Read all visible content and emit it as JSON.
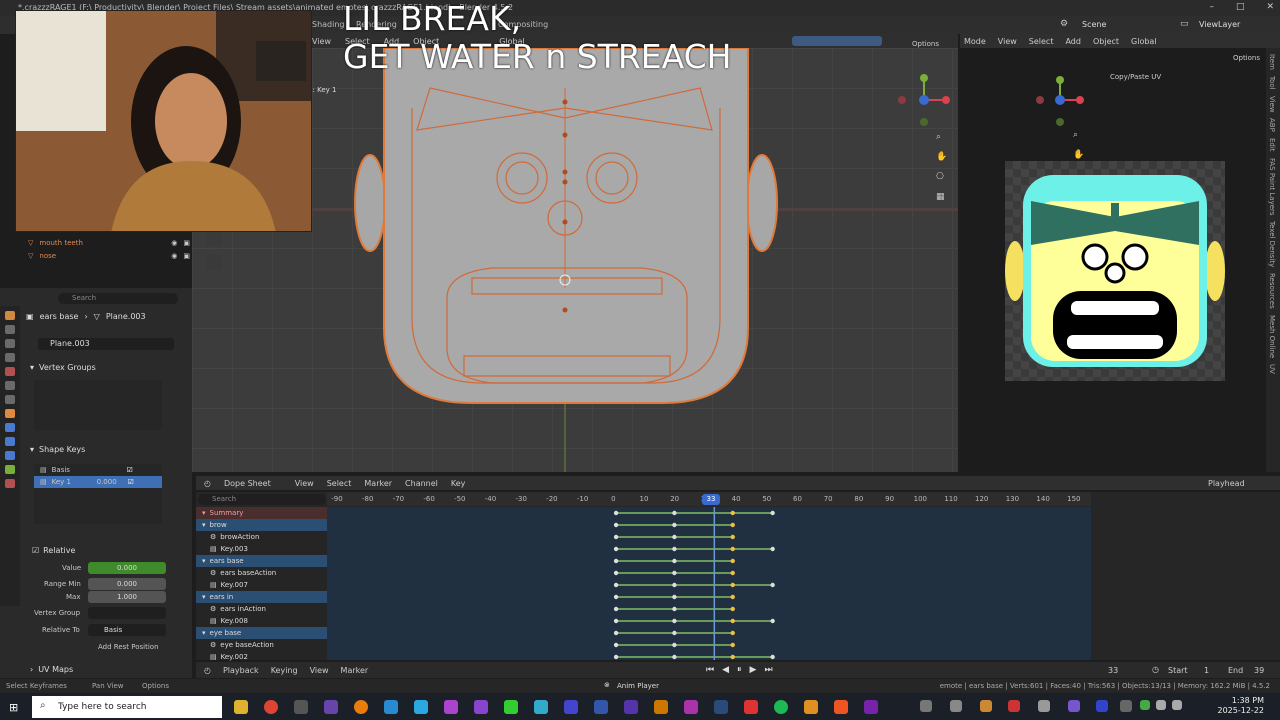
{
  "window": {
    "title": "*.crazzzRAGE1 (F:\\ Productivity\\ Blender\\ Project Files\\ Stream assets\\animated emotes\\ crazzzRAGE1.blend) - Blender 4.5.2",
    "controls": [
      "–",
      "□",
      "✕"
    ]
  },
  "topbar": {
    "tabs": [
      "Shading",
      "Rendering",
      "Compositing"
    ],
    "scene": "Scene",
    "view_layer": "ViewLayer"
  },
  "overlay": {
    "line1": "LIL BREAK,",
    "line2": "GET WATER n STREACH"
  },
  "viewport": {
    "menus": [
      "View",
      "Select",
      "Add",
      "Object"
    ],
    "transform": "Global",
    "options": "Options",
    "shape_label": "e : Key 1"
  },
  "uv": {
    "mode": "Mode",
    "menus": [
      "View",
      "Select",
      "Add",
      "Object"
    ],
    "transform": "Global",
    "options": "Options",
    "copy_paste": "Copy/Paste UV"
  },
  "right_tabs": [
    "Item",
    "Tool",
    "View",
    "ABP",
    "Edit",
    "FAS Paint Layers",
    "Texel Density",
    "Resources",
    "Mesh Online",
    "UV"
  ],
  "outliner": {
    "items": [
      {
        "label": "mouth teeth"
      },
      {
        "label": "nose"
      }
    ]
  },
  "props": {
    "search_placeholder": "Search",
    "breadcrumb_object": "ears base",
    "breadcrumb_mesh": "Plane.003",
    "mesh_name": "Plane.003",
    "vertex_groups": "Vertex Groups",
    "shape_keys": "Shape Keys",
    "keys": [
      {
        "name": "Basis",
        "value": ""
      },
      {
        "name": "Key 1",
        "value": "0.000"
      }
    ],
    "relative": "Relative",
    "value_label": "Value",
    "value": "0.000",
    "range_min_label": "Range Min",
    "range_min": "0.000",
    "max_label": "Max",
    "max": "1.000",
    "vertex_group_label": "Vertex Group",
    "relative_to_label": "Relative To",
    "relative_to": "Basis",
    "add_rest": "Add Rest Position",
    "uv_maps": "UV Maps"
  },
  "dopesheet": {
    "mode": "Dope Sheet",
    "menus": [
      "View",
      "Select",
      "Marker",
      "Channel",
      "Key"
    ],
    "playhead": "Playhead",
    "search_placeholder": "Search",
    "current_frame": "33",
    "ruler": [
      "-90",
      "-80",
      "-70",
      "-60",
      "-50",
      "-40",
      "-30",
      "-20",
      "-10",
      "0",
      "10",
      "20",
      "30",
      "40",
      "50",
      "60",
      "70",
      "80",
      "90",
      "100",
      "110",
      "120",
      "130",
      "140",
      "150"
    ],
    "channels": [
      {
        "label": "Summary",
        "kind": "sum"
      },
      {
        "label": "brow",
        "kind": "grp"
      },
      {
        "label": "browAction",
        "kind": "act"
      },
      {
        "label": "Key.003",
        "kind": "key"
      },
      {
        "label": "ears base",
        "kind": "grp"
      },
      {
        "label": "ears baseAction",
        "kind": "act"
      },
      {
        "label": "Key.007",
        "kind": "key"
      },
      {
        "label": "ears in",
        "kind": "grp"
      },
      {
        "label": "ears inAction",
        "kind": "act"
      },
      {
        "label": "Key.008",
        "kind": "key"
      },
      {
        "label": "eye base",
        "kind": "grp"
      },
      {
        "label": "eye baseAction",
        "kind": "act"
      },
      {
        "label": "Key.002",
        "kind": "key"
      }
    ],
    "footer_menus": [
      "Playback",
      "Keying",
      "View",
      "Marker"
    ],
    "frame": "33",
    "start_label": "Start",
    "start": "1",
    "end_label": "End",
    "end": "39"
  },
  "status": {
    "left": [
      "Select Keyframes",
      "Pan View",
      "Options"
    ],
    "center": "Anim Player",
    "right": "emote | ears base | Verts:601 | Faces:40 | Tris:563 | Objects:13/13 | Memory: 162.2 MiB | 4.5.2"
  },
  "taskbar": {
    "search_placeholder": "Type here to search",
    "time": "1:38 PM",
    "date": "2025-12-22"
  }
}
